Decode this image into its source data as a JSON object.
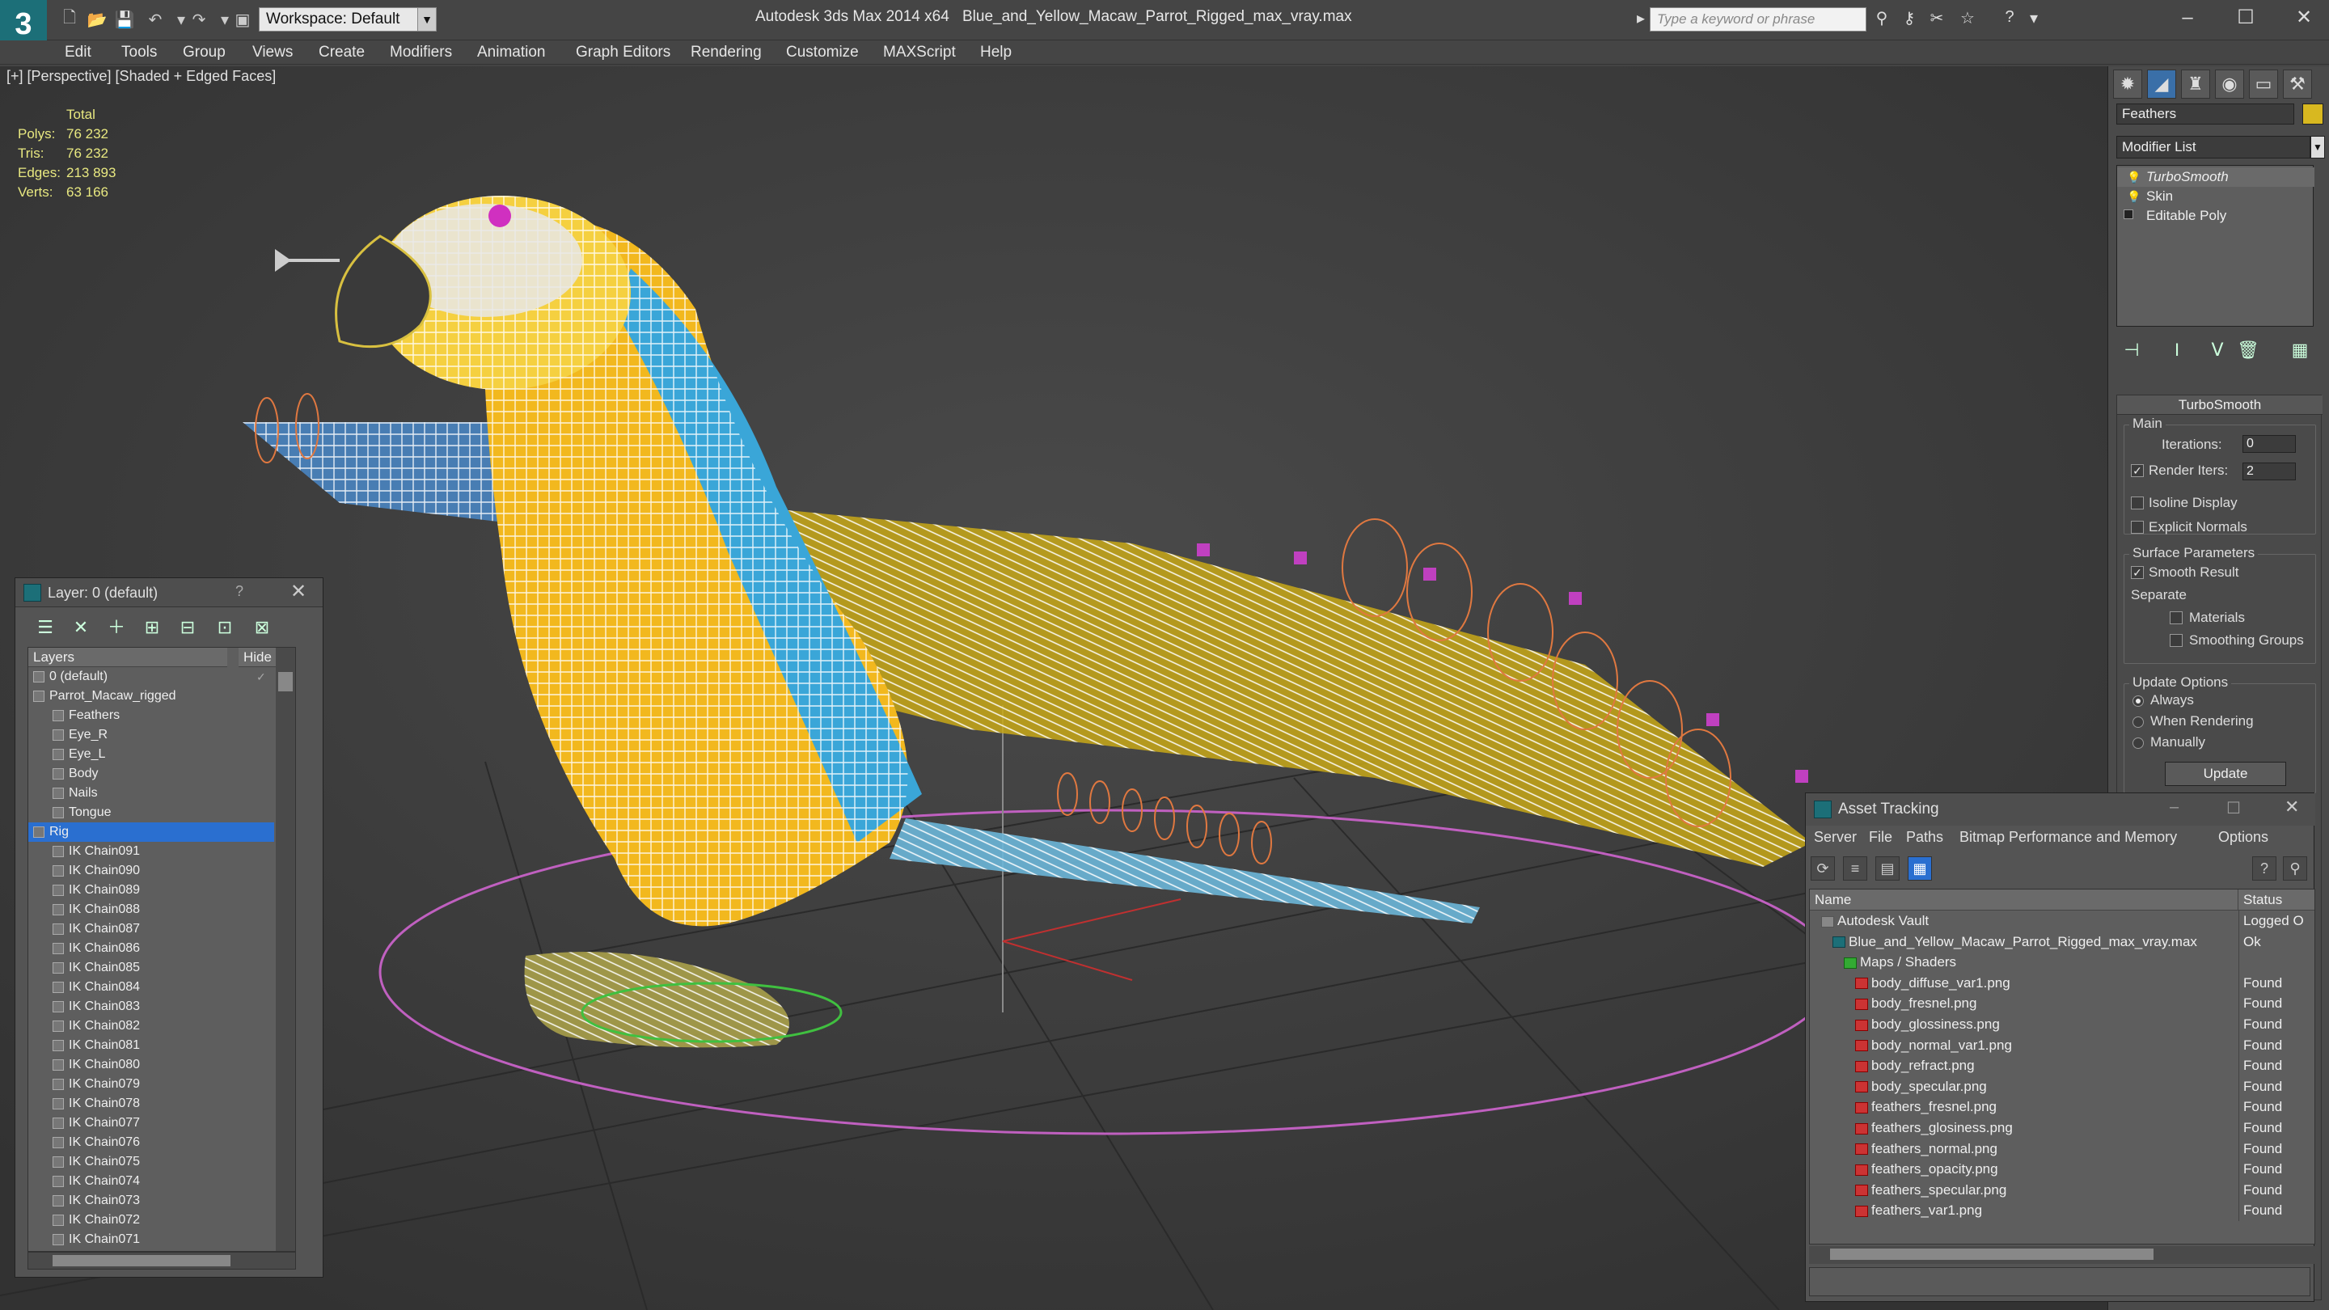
{
  "app_title": "Autodesk 3ds Max 2014 x64",
  "file_title": "Blue_and_Yellow_Macaw_Parrot_Rigged_max_vray.max",
  "workspace": "Workspace: Default",
  "search_placeholder": "Type a keyword or phrase",
  "menu": [
    "Edit",
    "Tools",
    "Group",
    "Views",
    "Create",
    "Modifiers",
    "Animation",
    "Graph Editors",
    "Rendering",
    "Customize",
    "MAXScript",
    "Help"
  ],
  "viewport": {
    "label": "[+] [Perspective] [Shaded + Edged Faces]",
    "stats": {
      "header": "Total",
      "rows": [
        {
          "k": "Polys:",
          "v": "76 232"
        },
        {
          "k": "Tris:",
          "v": "76 232"
        },
        {
          "k": "Edges:",
          "v": "213 893"
        },
        {
          "k": "Verts:",
          "v": "63 166"
        }
      ]
    }
  },
  "layer_panel": {
    "title": "Layer: 0 (default)",
    "help": "?",
    "col_layers": "Layers",
    "col_hide": "Hide",
    "rows": [
      {
        "name": "0 (default)",
        "indent": 1,
        "hide": "✓"
      },
      {
        "name": "Parrot_Macaw_rigged",
        "indent": 1,
        "hide": ""
      },
      {
        "name": "Feathers",
        "indent": 2,
        "hide": ""
      },
      {
        "name": "Eye_R",
        "indent": 2,
        "hide": ""
      },
      {
        "name": "Eye_L",
        "indent": 2,
        "hide": ""
      },
      {
        "name": "Body",
        "indent": 2,
        "hide": ""
      },
      {
        "name": "Nails",
        "indent": 2,
        "hide": ""
      },
      {
        "name": "Tongue",
        "indent": 2,
        "hide": ""
      },
      {
        "name": "Rig",
        "indent": 1,
        "hide": "",
        "selected": true
      },
      {
        "name": "IK Chain091",
        "indent": 2,
        "hide": ""
      },
      {
        "name": "IK Chain090",
        "indent": 2,
        "hide": ""
      },
      {
        "name": "IK Chain089",
        "indent": 2,
        "hide": ""
      },
      {
        "name": "IK Chain088",
        "indent": 2,
        "hide": ""
      },
      {
        "name": "IK Chain087",
        "indent": 2,
        "hide": ""
      },
      {
        "name": "IK Chain086",
        "indent": 2,
        "hide": ""
      },
      {
        "name": "IK Chain085",
        "indent": 2,
        "hide": ""
      },
      {
        "name": "IK Chain084",
        "indent": 2,
        "hide": ""
      },
      {
        "name": "IK Chain083",
        "indent": 2,
        "hide": ""
      },
      {
        "name": "IK Chain082",
        "indent": 2,
        "hide": ""
      },
      {
        "name": "IK Chain081",
        "indent": 2,
        "hide": ""
      },
      {
        "name": "IK Chain080",
        "indent": 2,
        "hide": ""
      },
      {
        "name": "IK Chain079",
        "indent": 2,
        "hide": ""
      },
      {
        "name": "IK Chain078",
        "indent": 2,
        "hide": ""
      },
      {
        "name": "IK Chain077",
        "indent": 2,
        "hide": ""
      },
      {
        "name": "IK Chain076",
        "indent": 2,
        "hide": ""
      },
      {
        "name": "IK Chain075",
        "indent": 2,
        "hide": ""
      },
      {
        "name": "IK Chain074",
        "indent": 2,
        "hide": ""
      },
      {
        "name": "IK Chain073",
        "indent": 2,
        "hide": ""
      },
      {
        "name": "IK Chain072",
        "indent": 2,
        "hide": ""
      },
      {
        "name": "IK Chain071",
        "indent": 2,
        "hide": ""
      }
    ]
  },
  "command_panel": {
    "object_name": "Feathers",
    "object_color": "#d8b820",
    "modifier_list": "Modifier List",
    "stack": [
      "TurboSmooth",
      "Skin",
      "Editable Poly"
    ],
    "rollout_title": "TurboSmooth",
    "main_label": "Main",
    "iterations_label": "Iterations:",
    "iterations_value": "0",
    "render_iters_label": "Render Iters:",
    "render_iters_value": "2",
    "isoline_label": "Isoline Display",
    "explicit_normals_label": "Explicit Normals",
    "surface_params_label": "Surface Parameters",
    "smooth_result_label": "Smooth Result",
    "separate_label": "Separate",
    "materials_label": "Materials",
    "smoothing_groups_label": "Smoothing Groups",
    "update_options_label": "Update Options",
    "always_label": "Always",
    "when_rendering_label": "When Rendering",
    "manually_label": "Manually",
    "update_button": "Update"
  },
  "asset_tracking": {
    "title": "Asset Tracking",
    "menu": [
      "Server",
      "File",
      "Paths",
      "Bitmap Performance and Memory",
      "Options"
    ],
    "col_name": "Name",
    "col_status": "Status",
    "rows": [
      {
        "name": "Autodesk Vault",
        "indent": 0,
        "status": "Logged O",
        "kind": "vault"
      },
      {
        "name": "Blue_and_Yellow_Macaw_Parrot_Rigged_max_vray.max",
        "indent": 1,
        "status": "Ok",
        "kind": "max"
      },
      {
        "name": "Maps / Shaders",
        "indent": 2,
        "status": "",
        "kind": "folder"
      },
      {
        "name": "body_diffuse_var1.png",
        "indent": 3,
        "status": "Found",
        "kind": "png"
      },
      {
        "name": "body_fresnel.png",
        "indent": 3,
        "status": "Found",
        "kind": "png"
      },
      {
        "name": "body_glossiness.png",
        "indent": 3,
        "status": "Found",
        "kind": "png"
      },
      {
        "name": "body_normal_var1.png",
        "indent": 3,
        "status": "Found",
        "kind": "png"
      },
      {
        "name": "body_refract.png",
        "indent": 3,
        "status": "Found",
        "kind": "png"
      },
      {
        "name": "body_specular.png",
        "indent": 3,
        "status": "Found",
        "kind": "png"
      },
      {
        "name": "feathers_fresnel.png",
        "indent": 3,
        "status": "Found",
        "kind": "png"
      },
      {
        "name": "feathers_glosiness.png",
        "indent": 3,
        "status": "Found",
        "kind": "png"
      },
      {
        "name": "feathers_normal.png",
        "indent": 3,
        "status": "Found",
        "kind": "png"
      },
      {
        "name": "feathers_opacity.png",
        "indent": 3,
        "status": "Found",
        "kind": "png"
      },
      {
        "name": "feathers_specular.png",
        "indent": 3,
        "status": "Found",
        "kind": "png"
      },
      {
        "name": "feathers_var1.png",
        "indent": 3,
        "status": "Found",
        "kind": "png"
      }
    ]
  },
  "colors": {
    "accent": "#2a6fd0",
    "parrot_yellow": "#f2b81e",
    "parrot_blue": "#3aa6d8",
    "wire": "#ffffff",
    "bone": "#e07840",
    "ground": "#c060c0"
  }
}
